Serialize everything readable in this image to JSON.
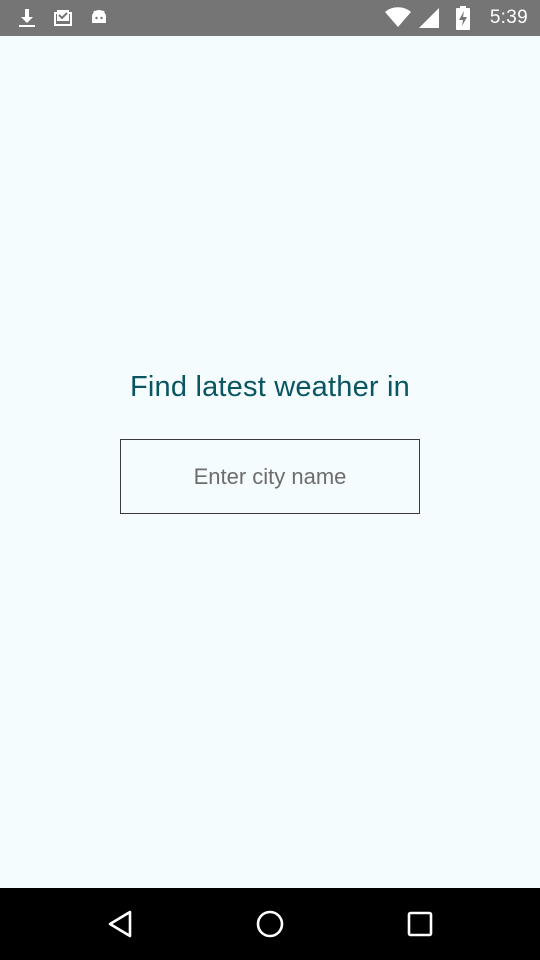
{
  "status_bar": {
    "time": "5:39",
    "icons": [
      "download-icon",
      "inbox-check-icon",
      "android-icon",
      "wifi-icon",
      "cellular-signal-icon",
      "battery-charging-icon"
    ]
  },
  "main": {
    "headline": "Find latest weather in",
    "city_input": {
      "placeholder": "Enter city name",
      "value": ""
    }
  },
  "nav_bar": {
    "buttons": [
      "back",
      "home",
      "recents"
    ]
  },
  "colors": {
    "status_bar": "#757575",
    "background": "#f4fcfe",
    "headline": "#0b5563",
    "nav_bar": "#000000"
  }
}
